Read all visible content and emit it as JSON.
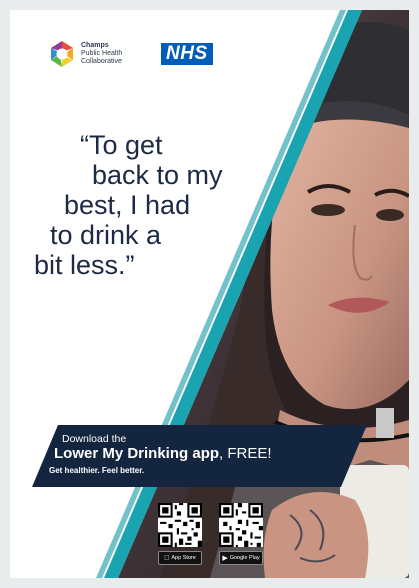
{
  "brand": {
    "champs_lines": [
      "Champs",
      "Public Health",
      "Collaborative"
    ],
    "nhs": "NHS"
  },
  "quote": {
    "lines": [
      "“To get",
      "back to my",
      "best, I had",
      "to drink a",
      "bit less.”"
    ]
  },
  "banner": {
    "download": "Download the",
    "app_name": "Lower My Drinking app",
    "free": ", FREE!",
    "tagline": "Get healthier. Feel better."
  },
  "stores": {
    "apple": "App Store",
    "google": "Google Play"
  },
  "icons": {
    "apple": "apple-icon",
    "google": "google-play-icon"
  },
  "colors": {
    "teal": "#1aa3b0",
    "navy": "#1d2a45",
    "nhs_blue": "#005eb8",
    "banner": "#14263f"
  }
}
